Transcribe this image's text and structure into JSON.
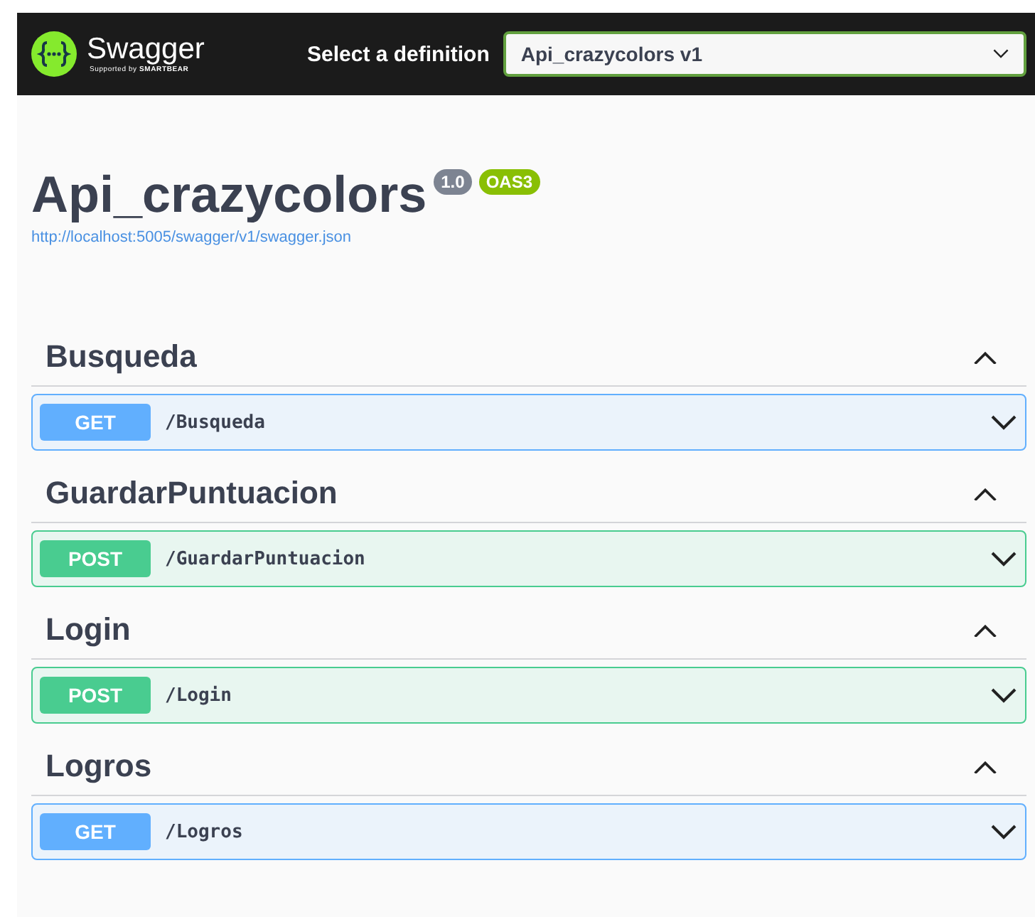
{
  "topbar": {
    "logo_name": "Swagger",
    "logo_tagline": "Supported by",
    "logo_brand": "SMARTBEAR",
    "definition_label": "Select a definition",
    "definition_value": "Api_crazycolors v1"
  },
  "info": {
    "title": "Api_crazycolors",
    "version": "1.0",
    "oas": "OAS3",
    "url": "http://localhost:5005/swagger/v1/swagger.json"
  },
  "tags": [
    {
      "name": "Busqueda",
      "expanded": true,
      "operations": [
        {
          "method": "GET",
          "path": "/Busqueda"
        }
      ]
    },
    {
      "name": "GuardarPuntuacion",
      "expanded": true,
      "operations": [
        {
          "method": "POST",
          "path": "/GuardarPuntuacion"
        }
      ]
    },
    {
      "name": "Login",
      "expanded": true,
      "operations": [
        {
          "method": "POST",
          "path": "/Login"
        }
      ]
    },
    {
      "name": "Logros",
      "expanded": true,
      "operations": [
        {
          "method": "GET",
          "path": "/Logros"
        }
      ]
    }
  ]
}
